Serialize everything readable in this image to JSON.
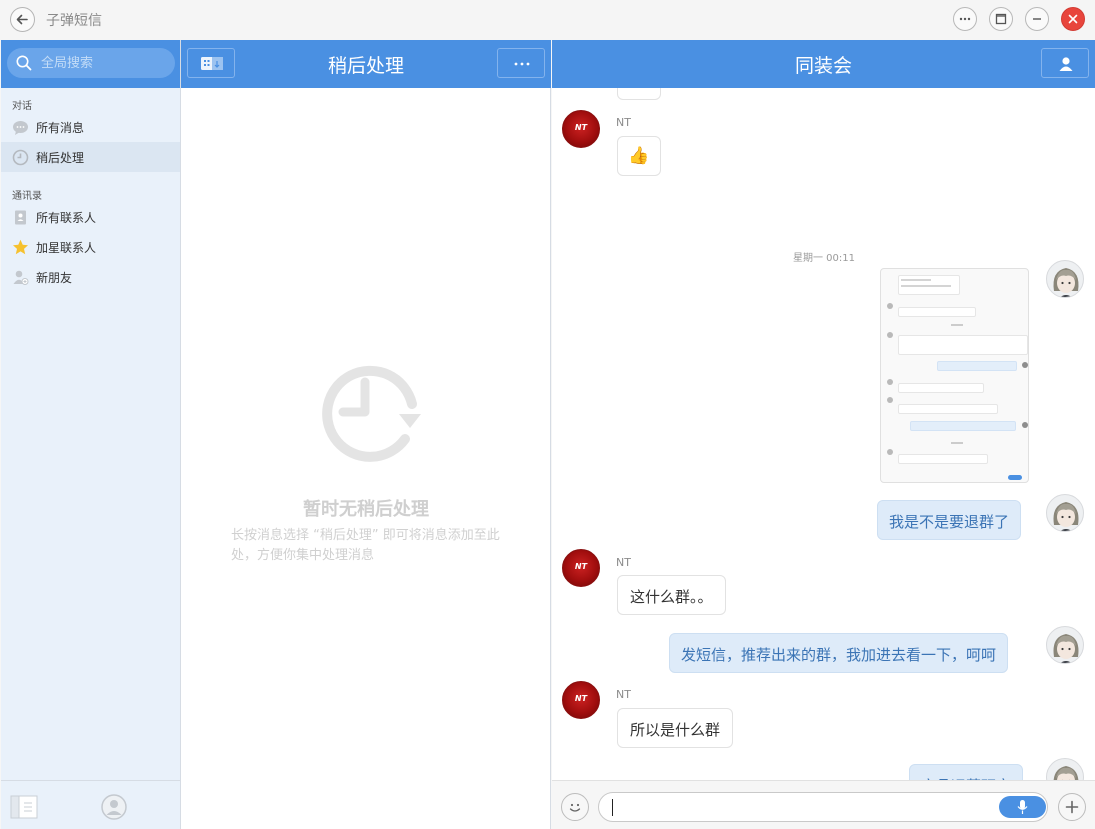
{
  "app": {
    "title": "子弹短信"
  },
  "sidebar": {
    "search_placeholder": "全局搜索",
    "section_conversations": "对话",
    "section_contacts": "通讯录",
    "items": [
      {
        "label": "所有消息",
        "icon": "chat-bubble-icon"
      },
      {
        "label": "稍后处理",
        "icon": "clock-icon",
        "active": true
      },
      {
        "label": "所有联系人",
        "icon": "contacts-book-icon"
      },
      {
        "label": "加星联系人",
        "icon": "star-icon"
      },
      {
        "label": "新朋友",
        "icon": "add-person-icon"
      }
    ]
  },
  "middle": {
    "title": "稍后处理",
    "empty_title": "暂时无稍后处理",
    "empty_desc": "长按消息选择 “稍后处理” 即可将消息添加至此处，方便你集中处理消息"
  },
  "chat": {
    "title": "同装会",
    "messages": [
      {
        "from": "NT",
        "type": "emoji",
        "content": "👍"
      },
      {
        "type": "timestamp",
        "content": "星期一 00:11"
      },
      {
        "from": "me",
        "type": "image"
      },
      {
        "from": "me",
        "type": "text",
        "content": "我是不是要退群了"
      },
      {
        "from": "NT",
        "type": "text",
        "content": "这什么群。。"
      },
      {
        "from": "me",
        "type": "text",
        "content": "发短信，推荐出来的群，我加进去看一下，呵呵"
      },
      {
        "from": "NT",
        "type": "text",
        "content": "所以是什么群"
      },
      {
        "from": "me",
        "type": "text",
        "content": "产品运营研究"
      }
    ],
    "input_value": ""
  },
  "colors": {
    "accent": "#4a90e2",
    "close": "#e8453c",
    "outgoing_bubble": "#deebf9"
  }
}
